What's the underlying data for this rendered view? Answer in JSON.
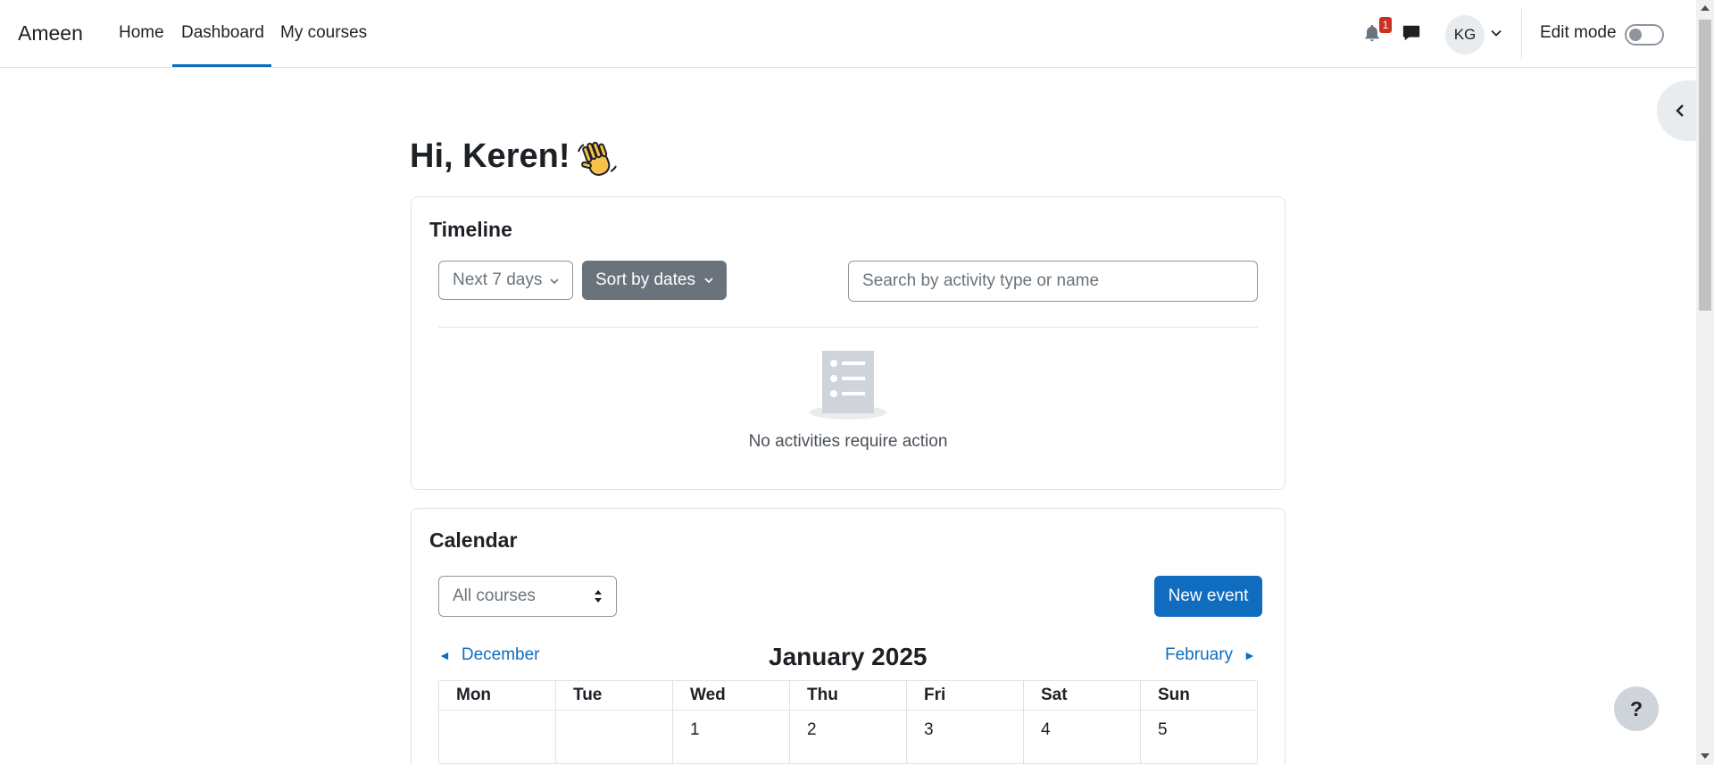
{
  "navbar": {
    "brand": "Ameen",
    "links": [
      {
        "label": "Home"
      },
      {
        "label": "Dashboard",
        "active": true
      },
      {
        "label": "My courses"
      }
    ],
    "notification_count": "1",
    "avatar_initials": "KG",
    "edit_mode_label": "Edit mode",
    "edit_mode_on": false
  },
  "greeting": "Hi, Keren! 👋",
  "greeting_text": "Hi, Keren!",
  "timeline": {
    "title": "Timeline",
    "range_filter": "Next 7 days",
    "sort_button": "Sort by dates",
    "search_placeholder": "Search by activity type or name",
    "empty_message": "No activities require action"
  },
  "calendar": {
    "title": "Calendar",
    "course_select": "All courses",
    "new_event_button": "New event",
    "prev_month": "December",
    "next_month": "February",
    "current_month": "January 2025",
    "weekdays": [
      "Mon",
      "Tue",
      "Wed",
      "Thu",
      "Fri",
      "Sat",
      "Sun"
    ],
    "first_week": [
      "",
      "",
      "1",
      "2",
      "3",
      "4",
      "5"
    ]
  },
  "help_button": "?",
  "colors": {
    "primary": "#0f6cbf",
    "secondary": "#6a737b",
    "badge": "#ca3120",
    "border": "#dee2e6"
  },
  "icons": {
    "notifications": "bell-icon",
    "messages": "chat-bubble-icon",
    "user_menu": "chevron-down-icon",
    "drawer": "chevron-left-icon",
    "empty_state": "list-document-icon"
  }
}
